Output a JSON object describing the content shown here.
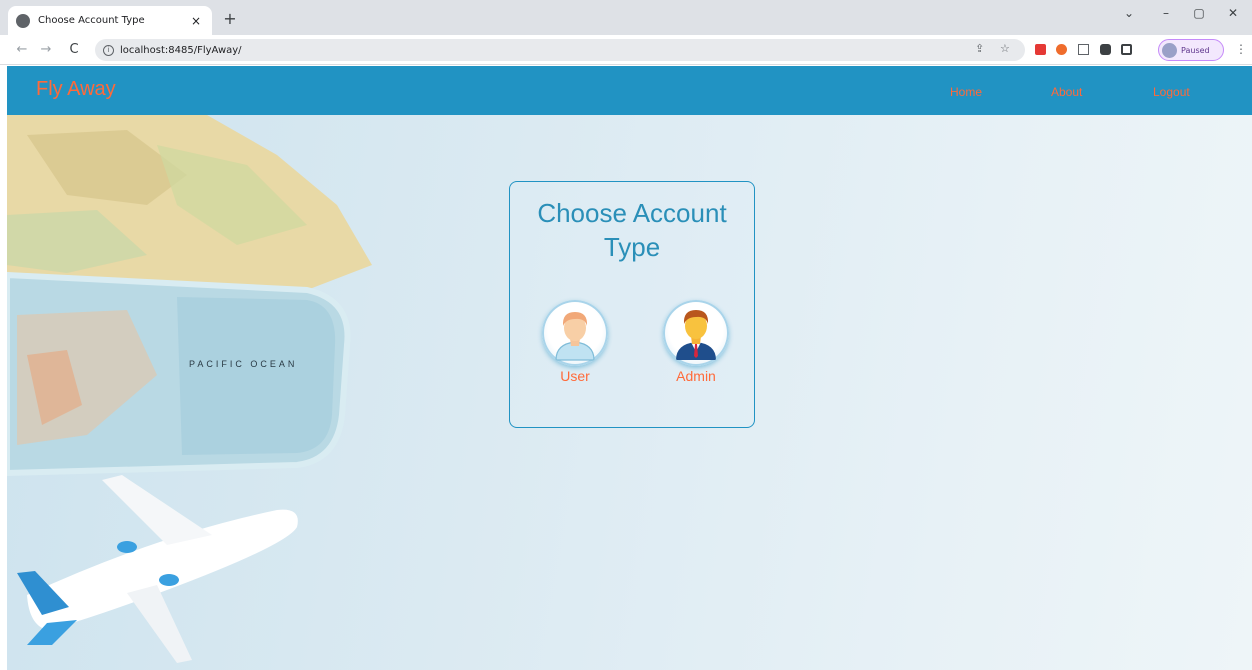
{
  "browser": {
    "tab_title": "Choose Account Type",
    "tab_close": "×",
    "new_tab": "+",
    "url": "localhost:8485/FlyAway/",
    "profile_label": "Paused",
    "window_controls": {
      "dropdown": "⌄",
      "minimize": "–",
      "maximize": "▢",
      "close": "✕"
    },
    "nav": {
      "back": "←",
      "forward": "→",
      "reload": "C"
    }
  },
  "site": {
    "brand": "Fly Away",
    "nav": [
      "Home",
      "About",
      "Logout"
    ],
    "colors": {
      "navbar": "#2193c3",
      "accent": "#ff6a3a",
      "title": "#2a8fb8"
    }
  },
  "card": {
    "title": "Choose Account Type",
    "options": [
      {
        "label": "User",
        "icon": "user-avatar-icon"
      },
      {
        "label": "Admin",
        "icon": "admin-avatar-icon"
      }
    ]
  },
  "background": {
    "map_label": "PACIFIC OCEAN"
  }
}
